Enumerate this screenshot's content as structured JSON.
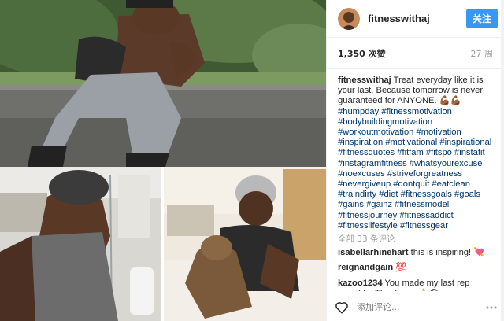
{
  "post": {
    "username": "fitnesswithaj",
    "follow_label": "关注",
    "likes": "1,350 次赞",
    "time_ago": "27 周",
    "caption_user": "fitnesswithaj",
    "caption_text": "Treat everyday like it is your last. Because tomorrow is never guaranteed for ANYONE. 💪🏾💪🏾",
    "caption_tags": "#humpday #fitnessmotivation #bodybuildingmotivation #workoutmotivation #motivation #inspiration #motivational #inspirational #fitnessquotes #fitfam #fitspo #instafit #instagramfitness #whatsyourexcuse #noexcuses #striveforgreatness #nevergiveup #dontquit #eatclean #traindirty #diet #fitnessgoals #goals #gains #gainz #fitnessmodel #fitnessjourney #fitnessaddict #fitnesslifestyle #fitnessgear",
    "load_more": "全部 33 条评论",
    "comments": [
      {
        "user": "isabellarhinehart",
        "text": "this is inspiring! 💘"
      },
      {
        "user": "reignandgain",
        "text": "💯"
      },
      {
        "user": "kazoo1234",
        "text": "You made my last rep possible. Thank you 🙏🏻😊"
      }
    ],
    "add_comment_placeholder": "添加评论..."
  },
  "icons": {
    "heart": "heart-outline-icon",
    "more": "more-options-icon"
  },
  "colors": {
    "follow": "#3897f0",
    "hashtag": "#003569",
    "muted": "#999999"
  }
}
